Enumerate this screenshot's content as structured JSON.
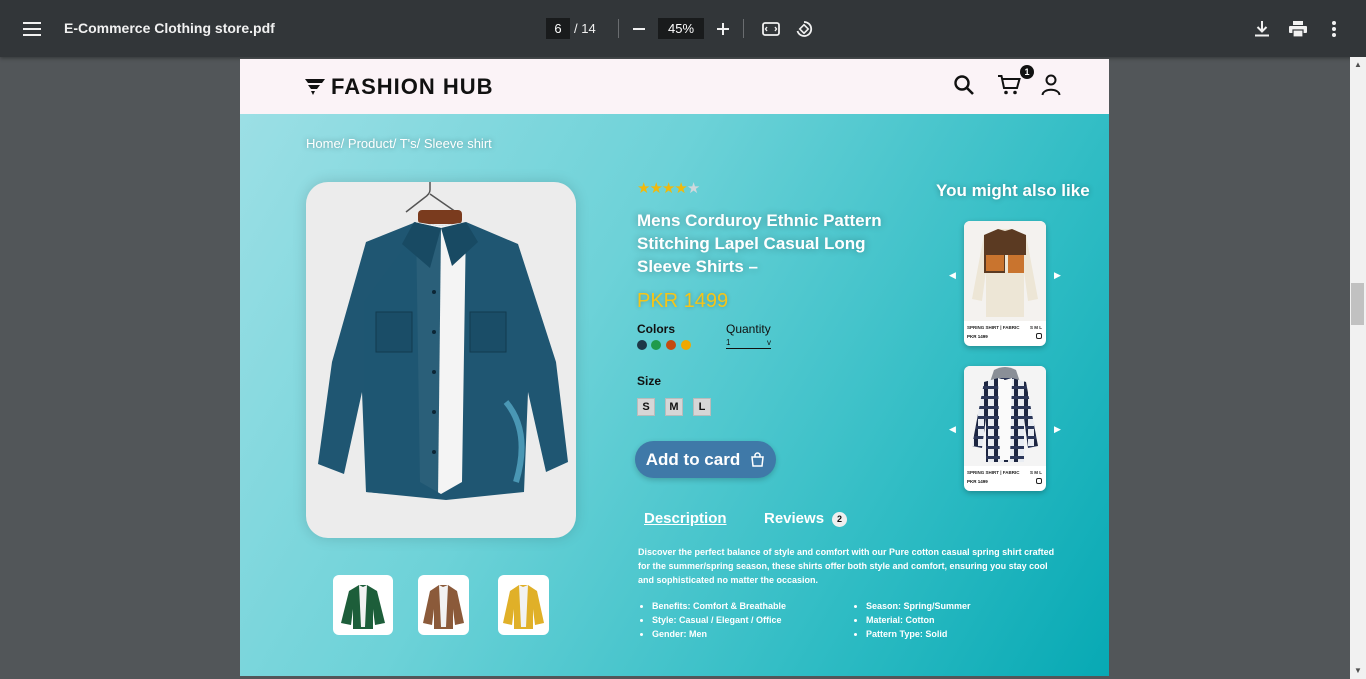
{
  "viewer": {
    "file_name": "E-Commerce Clothing store.pdf",
    "current_page": "6",
    "total_pages": "/ 14",
    "zoom": "45%"
  },
  "site": {
    "brand": "FASHION HUB",
    "cart_count": "1"
  },
  "breadcrumb": "Home/ Product/ T's/ Sleeve shirt",
  "product": {
    "rating": 4,
    "max_rating": 5,
    "title": "Mens Corduroy Ethnic Pattern Stitching Lapel Casual Long Sleeve Shirts –",
    "price": "PKR 1499",
    "colors_label": "Colors",
    "colors": [
      "#1e3848",
      "#1f9a4c",
      "#c44a10",
      "#f0a800"
    ],
    "quantity_label": "Quantity",
    "quantity_value": "1",
    "size_label": "Size",
    "sizes": [
      "S",
      "M",
      "L"
    ],
    "add_button": "Add to card",
    "thumbnail_colors": [
      "#1d5e3a",
      "#8b5a3a",
      "#e0b028"
    ]
  },
  "tabs": {
    "description": "Description",
    "reviews": "Reviews",
    "reviews_count": "2"
  },
  "description": "Discover the perfect balance of style and comfort with our Pure cotton casual spring shirt crafted for the summer/spring season, these shirts offer both style and comfort, ensuring you stay cool and sophisticated no matter the occasion.",
  "features_left": [
    "Benefits: Comfort & Breathable",
    "Style: Casual / Elegant / Office",
    "Gender: Men"
  ],
  "features_right": [
    "Season: Spring/Summer",
    "Material: Cotton",
    "Pattern Type: Solid"
  ],
  "related": {
    "heading": "You might also like",
    "items": [
      {
        "name": "SPRING SHIRT | FABRIC",
        "sizes": "S M L",
        "price": "PKR 1499"
      },
      {
        "name": "SPRING SHIRT | FABRIC",
        "sizes": "S M L",
        "price": "PKR 1499"
      }
    ]
  }
}
